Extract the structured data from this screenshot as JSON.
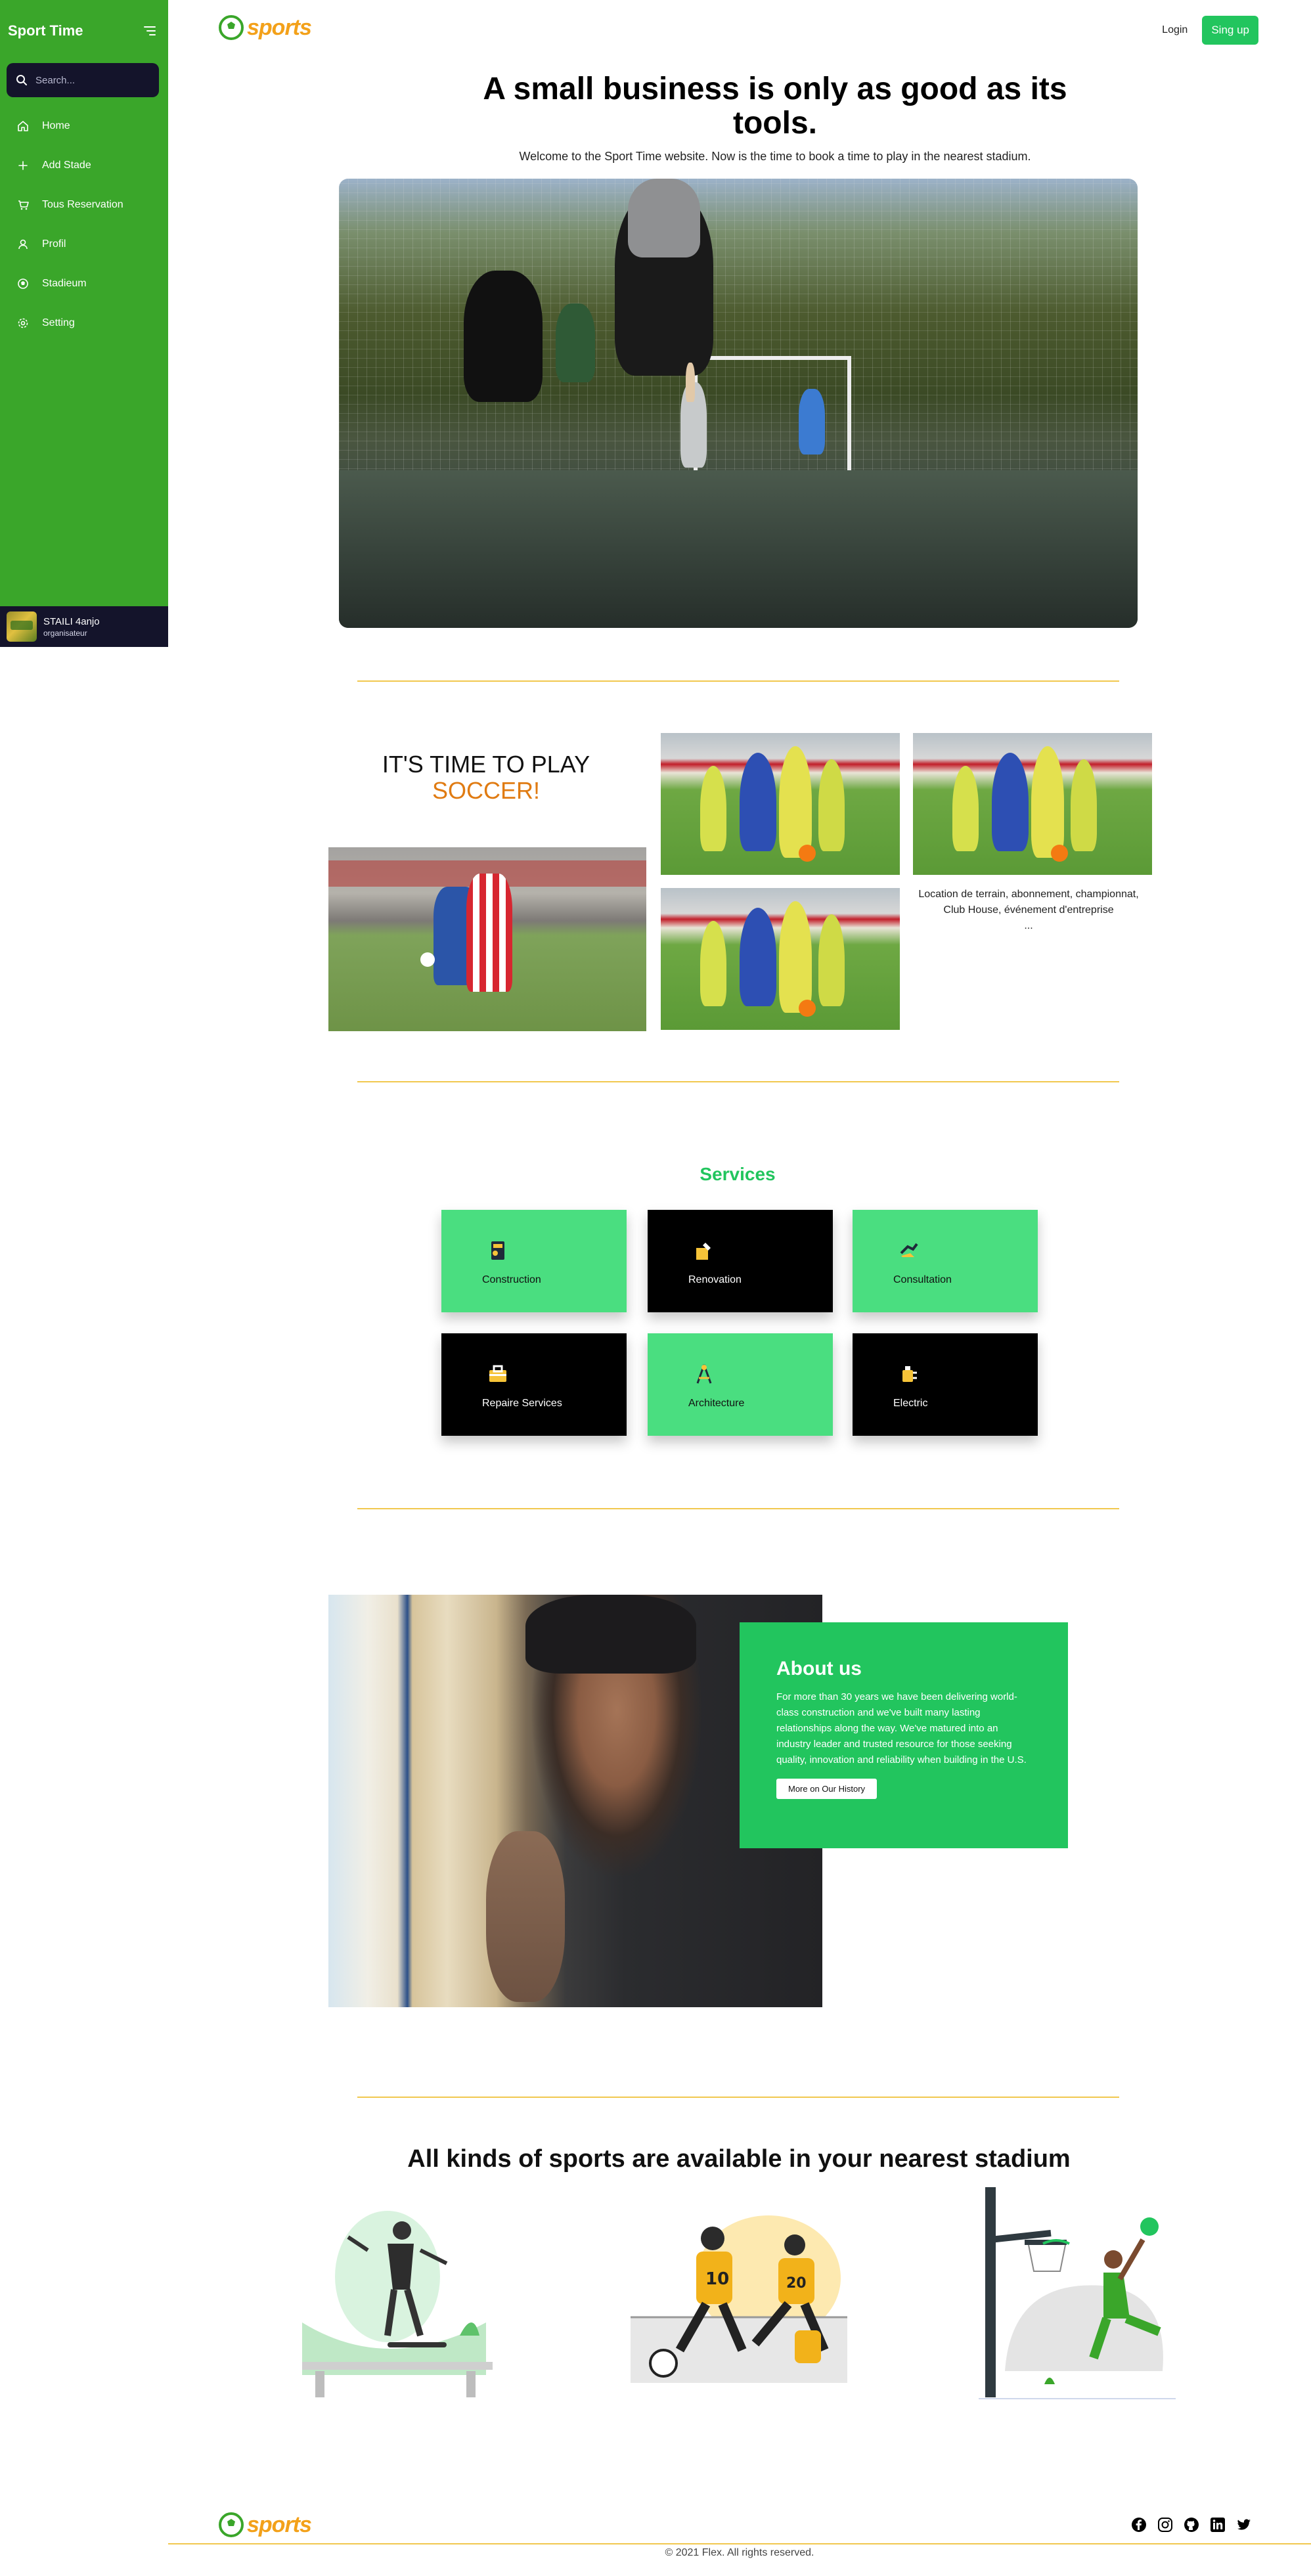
{
  "sidebar": {
    "title": "Sport Time",
    "search_placeholder": "Search...",
    "items": [
      {
        "label": "Home",
        "icon": "home-icon"
      },
      {
        "label": "Add Stade",
        "icon": "plus-icon"
      },
      {
        "label": "Tous Reservation",
        "icon": "cart-icon"
      },
      {
        "label": "Profil",
        "icon": "user-icon"
      },
      {
        "label": "Stadieum",
        "icon": "ball-icon"
      },
      {
        "label": "Setting",
        "icon": "gear-icon"
      }
    ],
    "profile": {
      "name": "STAILI 4anjo",
      "role": "organisateur"
    }
  },
  "header": {
    "logo_text": "sports",
    "login_label": "Login",
    "signup_label": "Sing up"
  },
  "hero": {
    "title": "A small business is only as good as its tools.",
    "subtitle": "Welcome to the Sport Time website. Now is the time to book a time to play in the nearest stadium."
  },
  "soccer": {
    "title_line1": "IT'S TIME TO PLAY",
    "title_line2": "SOCCER!",
    "caption": "Location de terrain, abonnement, championnat, Club House, événement d'entreprise",
    "caption_more": "..."
  },
  "services": {
    "title": "Services",
    "items": [
      {
        "label": "Construction",
        "style": "green"
      },
      {
        "label": "Renovation",
        "style": "black"
      },
      {
        "label": "Consultation",
        "style": "green"
      },
      {
        "label": "Repaire Services",
        "style": "black"
      },
      {
        "label": "Architecture",
        "style": "green"
      },
      {
        "label": "Electric",
        "style": "black"
      }
    ]
  },
  "about": {
    "title": "About us",
    "text": "For more than 30 years we have been delivering world-class construction and we've built many lasting relationships along the way. We've matured into an industry leader and trusted resource for those seeking quality, innovation and reliability when building in the U.S.",
    "button_label": "More on Our History"
  },
  "sports": {
    "title": "All kinds of sports are available in your nearest stadium"
  },
  "footer": {
    "logo_text": "sports",
    "copyright": "© 2021 Flex. All rights reserved.",
    "socials": [
      "facebook-icon",
      "instagram-icon",
      "github-icon",
      "linkedin-icon",
      "twitter-icon"
    ]
  },
  "colors": {
    "sidebar_green": "#3aa62a",
    "accent_green": "#22c55e",
    "card_green": "#4ade80",
    "logo_orange": "#f3a11a",
    "divider_yellow": "#f1c84e",
    "dark_navy": "#14142b"
  }
}
